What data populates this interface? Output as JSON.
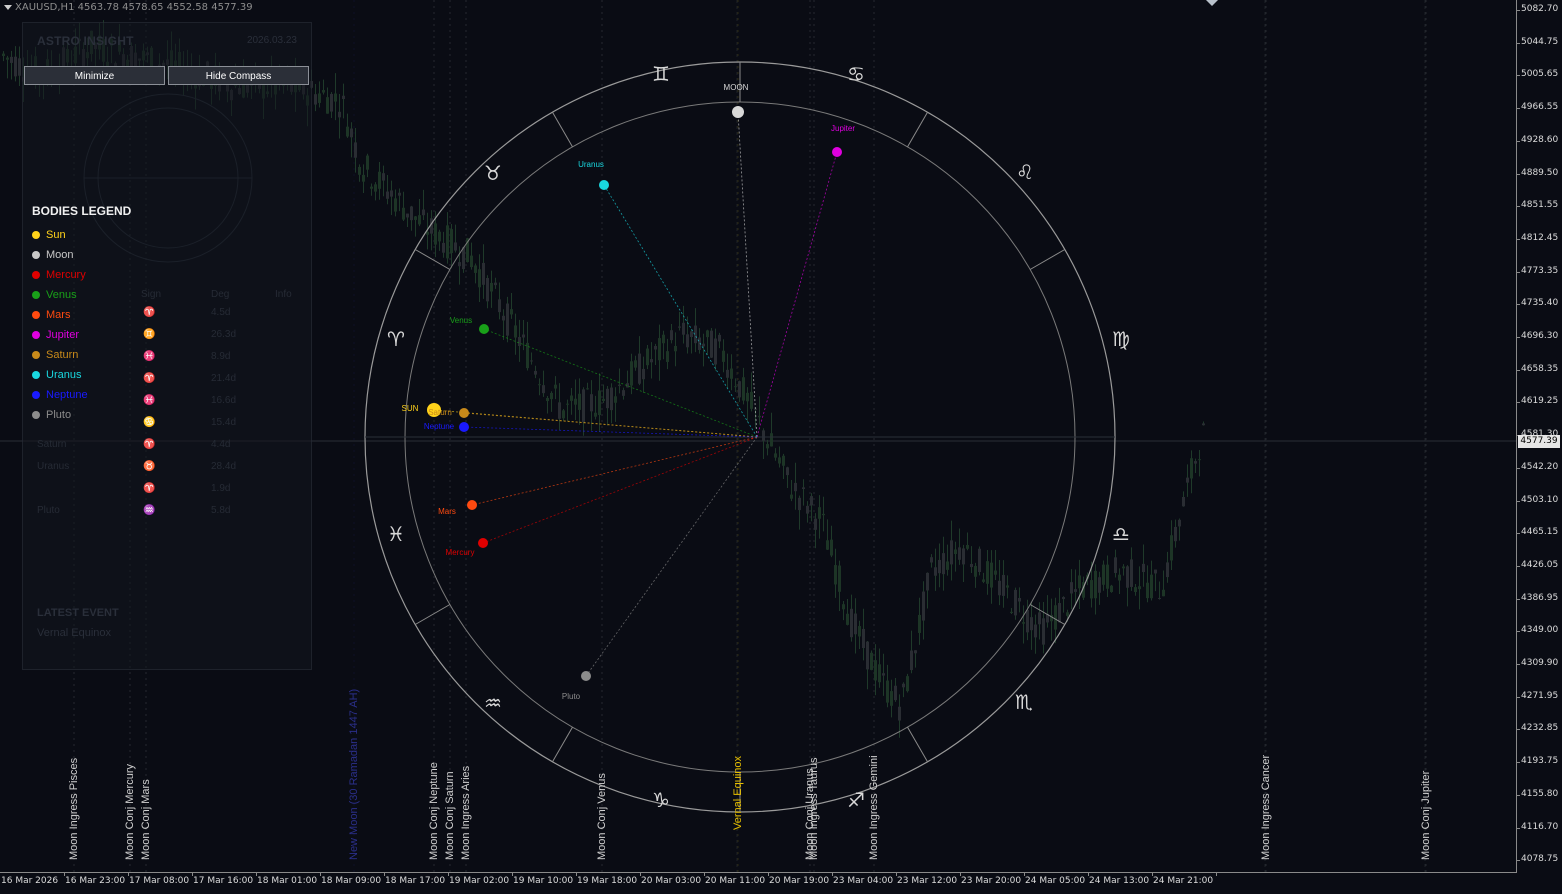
{
  "window": {
    "symbol_title": "XAUUSD,H1  4563.78 4578.65 4552.58 4577.39"
  },
  "panel": {
    "title": "ASTRO INSIGHT",
    "date": "2026.03.23",
    "buttons": {
      "minimize": "Minimize",
      "hide_compass": "Hide Compass"
    },
    "legend_title": "BODIES LEGEND",
    "legend": [
      {
        "name": "Sun",
        "color": "#ffd21a"
      },
      {
        "name": "Moon",
        "color": "#c8c8c8"
      },
      {
        "name": "Mercury",
        "color": "#e00000"
      },
      {
        "name": "Venus",
        "color": "#19a019"
      },
      {
        "name": "Mars",
        "color": "#ff4a10"
      },
      {
        "name": "Jupiter",
        "color": "#e000e0"
      },
      {
        "name": "Saturn",
        "color": "#c88a1a"
      },
      {
        "name": "Uranus",
        "color": "#19d8e0"
      },
      {
        "name": "Neptune",
        "color": "#1a1aff"
      },
      {
        "name": "Pluto",
        "color": "#8c8c8c"
      }
    ],
    "table_headers": {
      "sign": "Sign",
      "deg": "Deg",
      "info": "Info"
    },
    "table_rows": [
      {
        "body": "",
        "sign": "♈",
        "deg": "4.5d"
      },
      {
        "body": "",
        "sign": "♊",
        "deg": "26.3d"
      },
      {
        "body": "",
        "sign": "♓",
        "deg": "8.9d"
      },
      {
        "body": "",
        "sign": "♈",
        "deg": "21.4d"
      },
      {
        "body": "",
        "sign": "♓",
        "deg": "16.6d"
      },
      {
        "body": "",
        "sign": "♋",
        "deg": "15.4d"
      },
      {
        "body": "Saturn",
        "sign": "♈",
        "deg": "4.4d"
      },
      {
        "body": "Uranus",
        "sign": "♉",
        "deg": "28.4d"
      },
      {
        "body": "",
        "sign": "♈",
        "deg": "1.9d"
      },
      {
        "body": "Pluto",
        "sign": "♒",
        "deg": "5.8d"
      }
    ],
    "latest_title": "LATEST EVENT",
    "latest_value": "Vernal Equinox"
  },
  "price_axis": {
    "labels": [
      "5082.70",
      "5044.75",
      "5005.65",
      "4966.55",
      "4928.60",
      "4889.50",
      "4851.55",
      "4812.45",
      "4773.35",
      "4735.40",
      "4696.30",
      "4658.35",
      "4619.25",
      "4581.30",
      "4542.20",
      "4503.10",
      "4465.15",
      "4426.05",
      "4386.95",
      "4349.00",
      "4309.90",
      "4271.95",
      "4232.85",
      "4193.75",
      "4155.80",
      "4116.70",
      "4078.75"
    ],
    "current": "4577.39",
    "max": 5082.7,
    "min": 4078.75
  },
  "time_axis": {
    "labels": [
      "16 Mar 2026",
      "16 Mar 23:00",
      "17 Mar 08:00",
      "17 Mar 16:00",
      "18 Mar 01:00",
      "18 Mar 09:00",
      "18 Mar 17:00",
      "19 Mar 02:00",
      "19 Mar 10:00",
      "19 Mar 18:00",
      "20 Mar 03:00",
      "20 Mar 11:00",
      "20 Mar 19:00",
      "23 Mar 04:00",
      "23 Mar 12:00",
      "23 Mar 20:00",
      "24 Mar 05:00",
      "24 Mar 13:00",
      "24 Mar 21:00"
    ]
  },
  "events": [
    {
      "text": "Moon Ingress Pisces",
      "color": "#d0d0d0"
    },
    {
      "text": "Moon Conj Mercury",
      "color": "#d0d0d0"
    },
    {
      "text": "Moon Conj Mars",
      "color": "#d0d0d0"
    },
    {
      "text": "New Moon (30 Ramadan 1447 AH)",
      "color": "#2b2f8a"
    },
    {
      "text": "Moon Conj Neptune",
      "color": "#d0d0d0"
    },
    {
      "text": "Moon Conj Saturn",
      "color": "#d0d0d0"
    },
    {
      "text": "Moon Ingress Aries",
      "color": "#d0d0d0"
    },
    {
      "text": "Moon Conj Venus",
      "color": "#d0d0d0"
    },
    {
      "text": "Vernal Equinox",
      "color": "#e8c000"
    },
    {
      "text": "Moon Conj Uranus",
      "color": "#d0d0d0"
    },
    {
      "text": "Moon Ingress Taurus",
      "color": "#d0d0d0"
    },
    {
      "text": "Moon Ingress Gemini",
      "color": "#d0d0d0"
    },
    {
      "text": "Moon Ingress Cancer",
      "color": "#d0d0d0"
    },
    {
      "text": "Moon Conj Jupiter",
      "color": "#d0d0d0"
    }
  ],
  "compass": {
    "zodiac": [
      "♈",
      "♉",
      "♊",
      "♋",
      "♌",
      "♍",
      "♎",
      "♏",
      "♐",
      "♑",
      "♒",
      "♓"
    ],
    "planets": [
      {
        "label": "SUN",
        "color": "#ffd21a"
      },
      {
        "label": "MOON",
        "color": "#d8d8d8"
      },
      {
        "label": "Mercury",
        "color": "#e00000"
      },
      {
        "label": "Venus",
        "color": "#19a019"
      },
      {
        "label": "Mars",
        "color": "#ff4a10"
      },
      {
        "label": "Jupiter",
        "color": "#e000e0"
      },
      {
        "label": "Saturn",
        "color": "#c88a1a"
      },
      {
        "label": "Uranus",
        "color": "#19d8e0"
      },
      {
        "label": "Neptune",
        "color": "#1a1aff"
      },
      {
        "label": "Pluto",
        "color": "#8c8c8c"
      }
    ]
  }
}
